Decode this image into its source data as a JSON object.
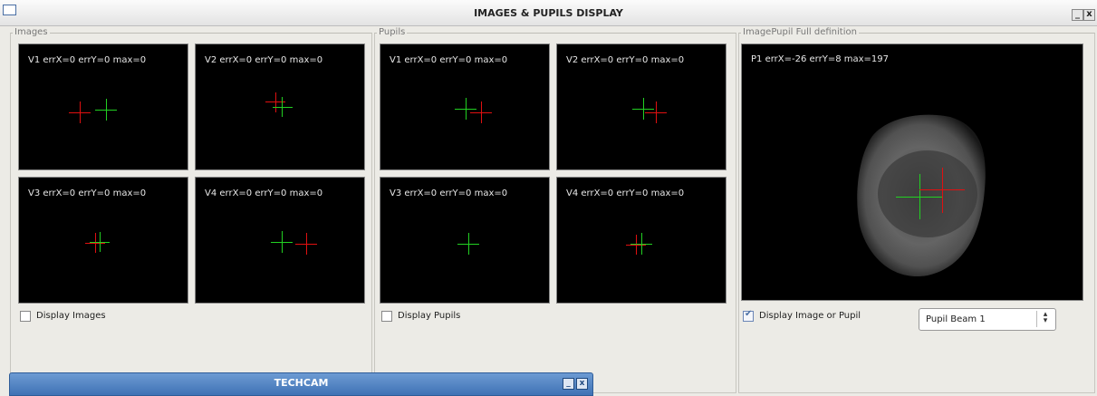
{
  "window": {
    "title": "IMAGES & PUPILS DISPLAY",
    "minimize_label": "_",
    "close_label": "x"
  },
  "images_group": {
    "title": "Images",
    "panels": [
      {
        "label": "V1 errX=0 errY=0 max=0"
      },
      {
        "label": "V2 errX=0 errY=0 max=0"
      },
      {
        "label": "V3 errX=0 errY=0 max=0"
      },
      {
        "label": "V4 errX=0 errY=0 max=0"
      }
    ],
    "checkbox_label": "Display Images",
    "checked": false
  },
  "pupils_group": {
    "title": "Pupils",
    "panels": [
      {
        "label": "V1 errX=0 errY=0 max=0"
      },
      {
        "label": "V2 errX=0 errY=0 max=0"
      },
      {
        "label": "V3 errX=0 errY=0 max=0"
      },
      {
        "label": "V4 errX=0 errY=0 max=0"
      }
    ],
    "checkbox_label": "Display Pupils",
    "checked": false
  },
  "full_group": {
    "title": "ImagePupil Full definition",
    "panel_label": "P1 errX=-26 errY=8 max=197",
    "checkbox_label": "Display Image or Pupil",
    "checked": true,
    "select_value": "Pupil Beam 1"
  },
  "techcam": {
    "title": "TECHCAM",
    "minimize_label": "_",
    "close_label": "x"
  },
  "colors": {
    "reference_cross": "#e01010",
    "measured_cross": "#22d022",
    "panel_bg": "#000000",
    "techcam_bar": "#4a7fc0"
  }
}
